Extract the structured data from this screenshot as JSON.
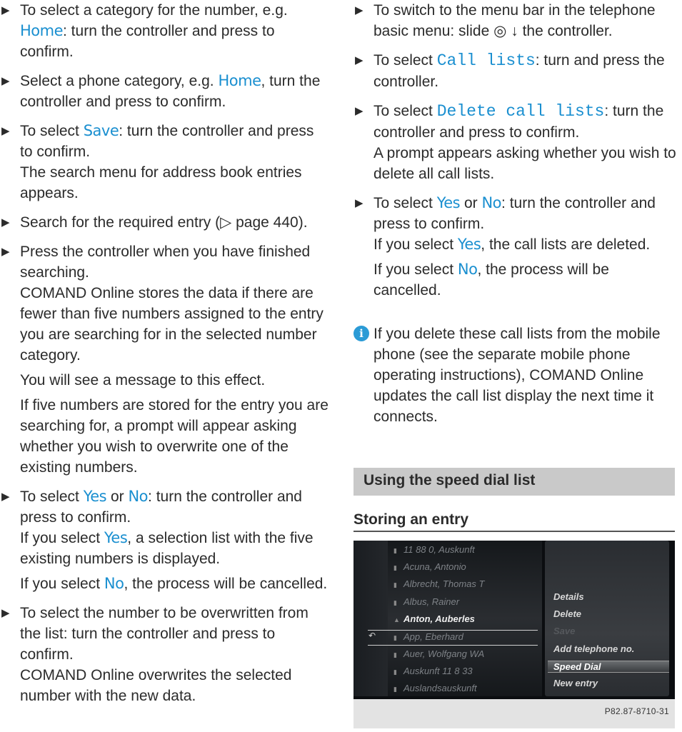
{
  "left_column": [
    {
      "type": "step",
      "parts": [
        {
          "t": "To select a category for the number, e.g. "
        },
        {
          "t": "Home",
          "s": "cond"
        },
        {
          "t": ": turn the controller and press to confirm."
        }
      ]
    },
    {
      "type": "step",
      "parts": [
        {
          "t": "Select a phone category, e.g. "
        },
        {
          "t": "Home",
          "s": "cond"
        },
        {
          "t": ", turn the controller and press to confirm."
        }
      ]
    },
    {
      "type": "step",
      "parts": [
        {
          "t": "To select "
        },
        {
          "t": "Save",
          "s": "cond"
        },
        {
          "t": ": turn the controller and press to confirm."
        }
      ],
      "follow": [
        "The search menu for address book entries appears."
      ]
    },
    {
      "type": "step",
      "parts": [
        {
          "t": "Search for the required entry (▷ page 440)."
        }
      ]
    },
    {
      "type": "step",
      "parts": [
        {
          "t": "Press the controller when you have finished searching."
        }
      ],
      "follow": [
        "COMAND Online stores the data if there are fewer than five numbers assigned to the entry you are searching for in the selected number category.",
        "You will see a message to this effect.",
        "If five numbers are stored for the entry you are searching for, a prompt will appear asking whether you wish to overwrite one of the existing numbers."
      ]
    },
    {
      "type": "step",
      "parts": [
        {
          "t": "To select "
        },
        {
          "t": "Yes",
          "s": "cond"
        },
        {
          "t": " or "
        },
        {
          "t": "No",
          "s": "cond"
        },
        {
          "t": ": turn the controller and press to confirm."
        }
      ],
      "follow_parts": [
        [
          {
            "t": "If you select "
          },
          {
            "t": "Yes",
            "s": "cond"
          },
          {
            "t": ", a selection list with the five existing numbers is displayed."
          }
        ],
        [
          {
            "t": "If you select "
          },
          {
            "t": "No",
            "s": "cond"
          },
          {
            "t": ", the process will be cancelled."
          }
        ]
      ]
    },
    {
      "type": "step",
      "parts": [
        {
          "t": "To select the number to be overwritten from the list: turn the controller and press to confirm."
        }
      ],
      "follow": [
        "COMAND Online overwrites the selected number with the new data."
      ]
    }
  ],
  "right_column": [
    {
      "type": "step",
      "parts": [
        {
          "t": "To switch to the menu bar in the telephone basic menu: slide ◎ ↓ the controller."
        }
      ]
    },
    {
      "type": "step",
      "parts": [
        {
          "t": "To select "
        },
        {
          "t": "Call lists",
          "s": "mono"
        },
        {
          "t": ": turn and press the controller."
        }
      ]
    },
    {
      "type": "step",
      "parts": [
        {
          "t": "To select "
        },
        {
          "t": "Delete call lists",
          "s": "mono"
        },
        {
          "t": ": turn the controller and press to confirm."
        }
      ],
      "follow": [
        "A prompt appears asking whether you wish to delete all call lists."
      ]
    },
    {
      "type": "step",
      "parts": [
        {
          "t": "To select "
        },
        {
          "t": "Yes",
          "s": "cond"
        },
        {
          "t": " or "
        },
        {
          "t": "No",
          "s": "cond"
        },
        {
          "t": ": turn the controller and press to confirm."
        }
      ],
      "follow_parts": [
        [
          {
            "t": "If you select "
          },
          {
            "t": "Yes",
            "s": "cond"
          },
          {
            "t": ", the call lists are deleted."
          }
        ],
        [
          {
            "t": "If you select "
          },
          {
            "t": "No",
            "s": "cond"
          },
          {
            "t": ", the process will be cancelled."
          }
        ]
      ]
    }
  ],
  "info_note": "If you delete these call lists from the mobile phone (see the separate mobile phone operating instructions), COMAND Online updates the call list display the next time it connects.",
  "section_title": "Using the speed dial list",
  "subsection_title": "Storing an entry",
  "screenshot": {
    "entries": [
      "11 88 0, Auskunft",
      "Acuna, Antonio",
      "Albrecht, Thomas T",
      "Albus, Rainer",
      "Anton, Auberles",
      "App, Eberhard",
      "Auer, Wolfgang WA",
      "Auskunft 11 8 33",
      "Auslandsauskunft"
    ],
    "selected_entry": "Anton, Auberles",
    "menu": [
      {
        "label": "Details",
        "state": "normal"
      },
      {
        "label": "Delete",
        "state": "normal"
      },
      {
        "label": "Save",
        "state": "disabled"
      },
      {
        "label": "Add telephone no.",
        "state": "normal"
      },
      {
        "label": "Speed Dial",
        "state": "highlighted"
      },
      {
        "label": "New entry",
        "state": "normal"
      }
    ],
    "image_code": "P82.87-8710-31"
  }
}
